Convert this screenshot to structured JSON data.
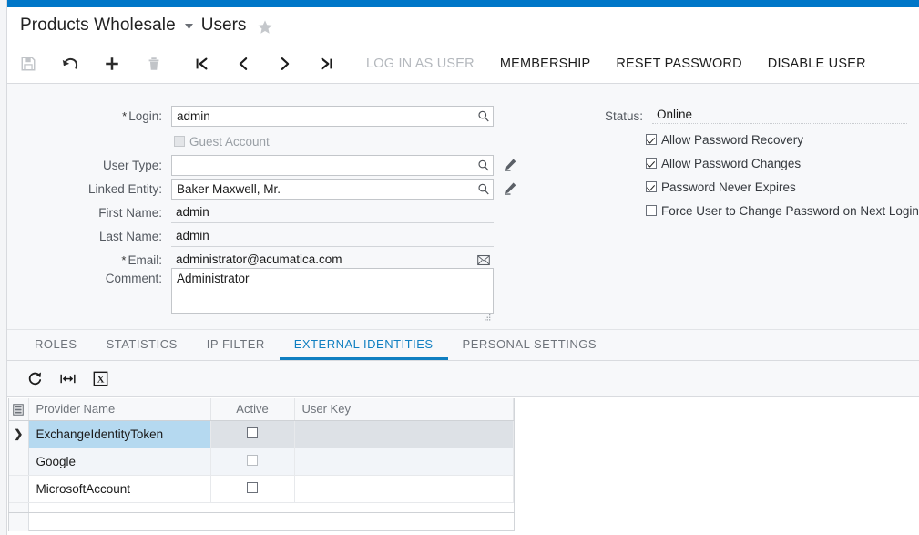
{
  "theme": {
    "accent": "#0077c8",
    "tab_active": "#0f7fc1",
    "row_selected": "#b5d9f0"
  },
  "titlebar": {
    "module": "Products Wholesale",
    "caret": "▼",
    "screen": "Users",
    "favorite_icon": "star-icon"
  },
  "toolbar": {
    "icons": [
      {
        "name": "save-icon",
        "label": "Save",
        "disabled": true
      },
      {
        "name": "undo-icon",
        "label": "Undo",
        "disabled": false
      },
      {
        "name": "add-icon",
        "label": "Add New Record",
        "disabled": false
      },
      {
        "name": "delete-icon",
        "label": "Delete",
        "disabled": true
      },
      {
        "name": "first-record-icon",
        "label": "First",
        "disabled": false
      },
      {
        "name": "previous-record-icon",
        "label": "Previous",
        "disabled": false
      },
      {
        "name": "next-record-icon",
        "label": "Next",
        "disabled": false
      },
      {
        "name": "last-record-icon",
        "label": "Last",
        "disabled": false
      }
    ],
    "buttons": [
      {
        "label": "LOG IN AS USER",
        "disabled": true
      },
      {
        "label": "MEMBERSHIP",
        "disabled": false
      },
      {
        "label": "RESET PASSWORD",
        "disabled": false
      },
      {
        "label": "DISABLE USER",
        "disabled": false
      }
    ]
  },
  "form": {
    "login": {
      "label": "Login:",
      "required": true,
      "value": "admin",
      "placeholder": ""
    },
    "guest_account": {
      "label": "Guest Account",
      "checked": false,
      "disabled": true
    },
    "user_type": {
      "label": "User Type:",
      "required": false,
      "value": "",
      "placeholder": ""
    },
    "linked_entity": {
      "label": "Linked Entity:",
      "required": false,
      "value": "Baker Maxwell, Mr.",
      "placeholder": ""
    },
    "first_name": {
      "label": "First Name:",
      "required": false,
      "value": "admin",
      "placeholder": ""
    },
    "last_name": {
      "label": "Last Name:",
      "required": false,
      "value": "admin",
      "placeholder": ""
    },
    "email": {
      "label": "Email:",
      "required": true,
      "value": "administrator@acumatica.com",
      "placeholder": ""
    },
    "comment": {
      "label": "Comment:",
      "value": "Administrator",
      "placeholder": ""
    },
    "status": {
      "label": "Status:",
      "value": "Online"
    },
    "options": [
      {
        "label": "Allow Password Recovery",
        "checked": true
      },
      {
        "label": "Allow Password Changes",
        "checked": true
      },
      {
        "label": "Password Never Expires",
        "checked": true
      },
      {
        "label": "Force User to Change Password on Next Login",
        "checked": false
      }
    ]
  },
  "tabs": [
    {
      "label": "ROLES",
      "active": false
    },
    {
      "label": "STATISTICS",
      "active": false
    },
    {
      "label": "IP FILTER",
      "active": false
    },
    {
      "label": "EXTERNAL IDENTITIES",
      "active": true
    },
    {
      "label": "PERSONAL SETTINGS",
      "active": false
    }
  ],
  "grid_toolbar": {
    "icons": [
      {
        "name": "refresh-icon",
        "label": "Refresh"
      },
      {
        "name": "fit-to-screen-icon",
        "label": "Fit to Screen"
      },
      {
        "name": "export-to-excel-icon",
        "label": "Export to Excel"
      }
    ]
  },
  "grid": {
    "settings_icon": "grid-settings-icon",
    "columns": [
      "Provider Name",
      "Active",
      "User Key"
    ],
    "rows": [
      {
        "selector": "❯",
        "provider_name": "ExchangeIdentityToken",
        "active": false,
        "user_key": "",
        "selected": true
      },
      {
        "selector": "",
        "provider_name": "Google",
        "active": false,
        "user_key": "",
        "selected": false
      },
      {
        "selector": "",
        "provider_name": "MicrosoftAccount",
        "active": false,
        "user_key": "",
        "selected": false
      }
    ]
  }
}
